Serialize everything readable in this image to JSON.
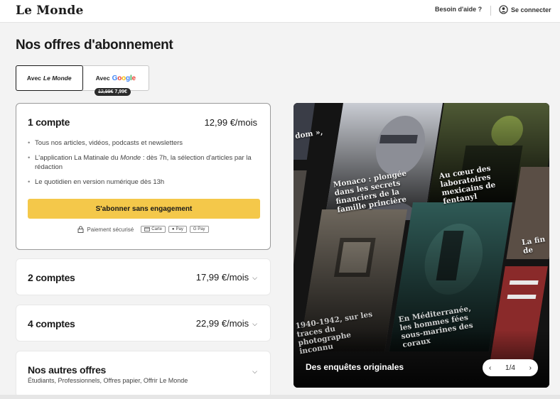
{
  "header": {
    "logo": "Le Monde",
    "help_link": "Besoin d'aide ?",
    "login_link": "Se connecter"
  },
  "page_title": "Nos offres d'abonnement",
  "tabs": {
    "lemonde_prefix": "Avec",
    "lemonde_brand": "Le Monde",
    "google_prefix": "Avec",
    "google_brand": [
      "G",
      "o",
      "o",
      "g",
      "l",
      "e"
    ],
    "promo_old_price": "12,99€",
    "promo_new_price": "7,99€"
  },
  "offers": [
    {
      "title": "1 compte",
      "price": "12,99 €/mois",
      "features": [
        {
          "text": "Tous nos articles, vidéos, podcasts et newsletters"
        },
        {
          "before": "L'application La Matinale du ",
          "italic": "Monde",
          "after": " : dès 7h, la sélection d'articles par la rédaction"
        },
        {
          "text": "Le quotidien en version numérique dès 13h"
        }
      ],
      "cta": "S'abonner sans engagement",
      "secure_label": "Paiement sécurisé",
      "payment_methods": [
        "Carte",
        "Pay",
        "G Pay"
      ]
    },
    {
      "title": "2 comptes",
      "price": "17,99 €/mois"
    },
    {
      "title": "4 comptes",
      "price": "22,99 €/mois"
    }
  ],
  "other_offers": {
    "title": "Nos autres offres",
    "subtitle": "Étudiants, Professionnels, Offres papier, Offrir Le Monde"
  },
  "hero": {
    "label": "Des enquêtes originales",
    "pager": "1/4",
    "captions": [
      "dom »,",
      "Monaco : plongée dans les secrets financiers de la famille princière",
      "Au cœur des laboratoires mexicains de fentanyl",
      "1940-1942, sur les traces du photographe inconnu",
      "En Méditerranée, les hommes fées sous-marines des coraux",
      "La fin de"
    ]
  },
  "colors": {
    "cta": "#f4c84a",
    "page_bg": "#f3f3f3",
    "hero_bg": "#111111"
  }
}
